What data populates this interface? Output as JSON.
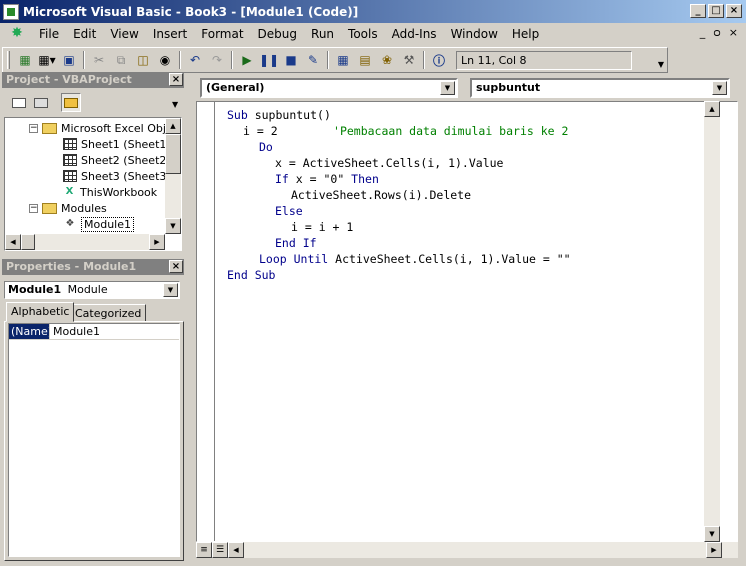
{
  "window": {
    "title": "Microsoft Visual Basic - Book3 - [Module1 (Code)]",
    "controls": [
      "_",
      "□",
      "×"
    ]
  },
  "menu": {
    "items": [
      "File",
      "Edit",
      "View",
      "Insert",
      "Format",
      "Debug",
      "Run",
      "Tools",
      "Add-Ins",
      "Window",
      "Help"
    ],
    "mdi_controls": [
      "_",
      "ᴑ",
      "×"
    ]
  },
  "toolbar": {
    "status": "Ln 11, Col 8"
  },
  "project_panel": {
    "title": "Project - VBAProject",
    "tree": [
      {
        "label": "Microsoft Excel Objec",
        "type": "folder",
        "expander": "−"
      },
      {
        "label": "Sheet1 (Sheet1)",
        "type": "sheet"
      },
      {
        "label": "Sheet2 (Sheet2)",
        "type": "sheet"
      },
      {
        "label": "Sheet3 (Sheet3)",
        "type": "sheet"
      },
      {
        "label": "ThisWorkbook",
        "type": "workbook"
      },
      {
        "label": "Modules",
        "type": "folder",
        "expander": "−"
      },
      {
        "label": "Module1",
        "type": "module"
      }
    ]
  },
  "properties_panel": {
    "title": "Properties - Module1",
    "object_name": "Module1",
    "object_type": "Module",
    "tabs": [
      "Alphabetic",
      "Categorized"
    ],
    "rows": [
      {
        "name": "(Name)",
        "value": "Module1"
      }
    ]
  },
  "code_window": {
    "object_combo": "(General)",
    "procedure_combo": "supbuntut",
    "lines": [
      {
        "indent": 0,
        "parts": [
          {
            "t": "Sub ",
            "c": "kw"
          },
          {
            "t": "supbuntut()",
            "c": "tx"
          }
        ]
      },
      {
        "indent": 1,
        "parts": [
          {
            "t": "i = 2        ",
            "c": "tx"
          },
          {
            "t": "'Pembacaan data dimulai baris ke 2",
            "c": "cm"
          }
        ]
      },
      {
        "indent": 2,
        "parts": [
          {
            "t": "Do",
            "c": "kw"
          }
        ]
      },
      {
        "indent": 3,
        "parts": [
          {
            "t": "x = ActiveSheet.Cells(i, 1).Value",
            "c": "tx"
          }
        ]
      },
      {
        "indent": 3,
        "parts": [
          {
            "t": "If ",
            "c": "kw"
          },
          {
            "t": "x = \"0\" ",
            "c": "tx"
          },
          {
            "t": "Then",
            "c": "kw"
          }
        ]
      },
      {
        "indent": 4,
        "parts": [
          {
            "t": "ActiveSheet.Rows(i).Delete",
            "c": "tx"
          }
        ]
      },
      {
        "indent": 3,
        "parts": [
          {
            "t": "Else",
            "c": "kw"
          }
        ]
      },
      {
        "indent": 4,
        "parts": [
          {
            "t": "i = i + 1",
            "c": "tx"
          }
        ]
      },
      {
        "indent": 3,
        "parts": [
          {
            "t": "End If",
            "c": "kw"
          }
        ]
      },
      {
        "indent": 2,
        "parts": [
          {
            "t": "Loop Until ",
            "c": "kw"
          },
          {
            "t": "ActiveSheet.Cells(i, 1).Value = \"\"",
            "c": "tx"
          }
        ]
      },
      {
        "indent": 0,
        "parts": [
          {
            "t": "End Sub",
            "c": "kw"
          }
        ]
      }
    ]
  }
}
